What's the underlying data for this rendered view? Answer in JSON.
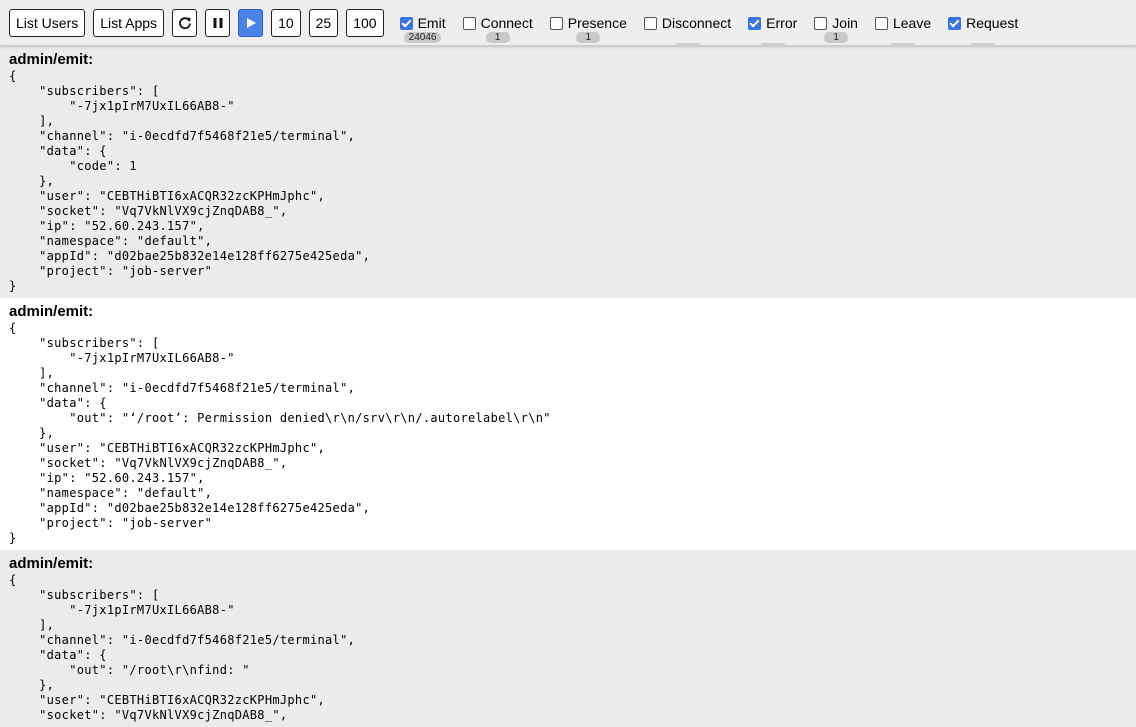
{
  "toolbar": {
    "list_users": "List Users",
    "list_apps": "List Apps",
    "refresh_icon": "refresh-icon",
    "pause_icon": "pause-icon",
    "play_icon": "play-icon",
    "limit_10": "10",
    "limit_25": "25",
    "limit_100": "100",
    "accent_color": "#4a82e6"
  },
  "filters": [
    {
      "label": "Emit",
      "checked": true,
      "count": "24046"
    },
    {
      "label": "Connect",
      "checked": false,
      "count": "1"
    },
    {
      "label": "Presence",
      "checked": false,
      "count": "1"
    },
    {
      "label": "Disconnect",
      "checked": false,
      "count": ""
    },
    {
      "label": "Error",
      "checked": true,
      "count": ""
    },
    {
      "label": "Join",
      "checked": false,
      "count": "1"
    },
    {
      "label": "Leave",
      "checked": false,
      "count": ""
    },
    {
      "label": "Request",
      "checked": true,
      "count": ""
    }
  ],
  "entries": [
    {
      "title": "admin/emit:",
      "body": "{\n    \"subscribers\": [\n        \"-7jx1pIrM7UxIL66AB8-\"\n    ],\n    \"channel\": \"i-0ecdfd7f5468f21e5/terminal\",\n    \"data\": {\n        \"code\": 1\n    },\n    \"user\": \"CEBTHiBTI6xACQR32zcKPHmJphc\",\n    \"socket\": \"Vq7VkNlVX9cjZnqDAB8_\",\n    \"ip\": \"52.60.243.157\",\n    \"namespace\": \"default\",\n    \"appId\": \"d02bae25b832e14e128ff6275e425eda\",\n    \"project\": \"job-server\"\n}"
    },
    {
      "title": "admin/emit:",
      "body": "{\n    \"subscribers\": [\n        \"-7jx1pIrM7UxIL66AB8-\"\n    ],\n    \"channel\": \"i-0ecdfd7f5468f21e5/terminal\",\n    \"data\": {\n        \"out\": \"‘/root’: Permission denied\\r\\n/srv\\r\\n/.autorelabel\\r\\n\"\n    },\n    \"user\": \"CEBTHiBTI6xACQR32zcKPHmJphc\",\n    \"socket\": \"Vq7VkNlVX9cjZnqDAB8_\",\n    \"ip\": \"52.60.243.157\",\n    \"namespace\": \"default\",\n    \"appId\": \"d02bae25b832e14e128ff6275e425eda\",\n    \"project\": \"job-server\"\n}"
    },
    {
      "title": "admin/emit:",
      "body": "{\n    \"subscribers\": [\n        \"-7jx1pIrM7UxIL66AB8-\"\n    ],\n    \"channel\": \"i-0ecdfd7f5468f21e5/terminal\",\n    \"data\": {\n        \"out\": \"/root\\r\\nfind: \"\n    },\n    \"user\": \"CEBTHiBTI6xACQR32zcKPHmJphc\",\n    \"socket\": \"Vq7VkNlVX9cjZnqDAB8_\","
    }
  ]
}
